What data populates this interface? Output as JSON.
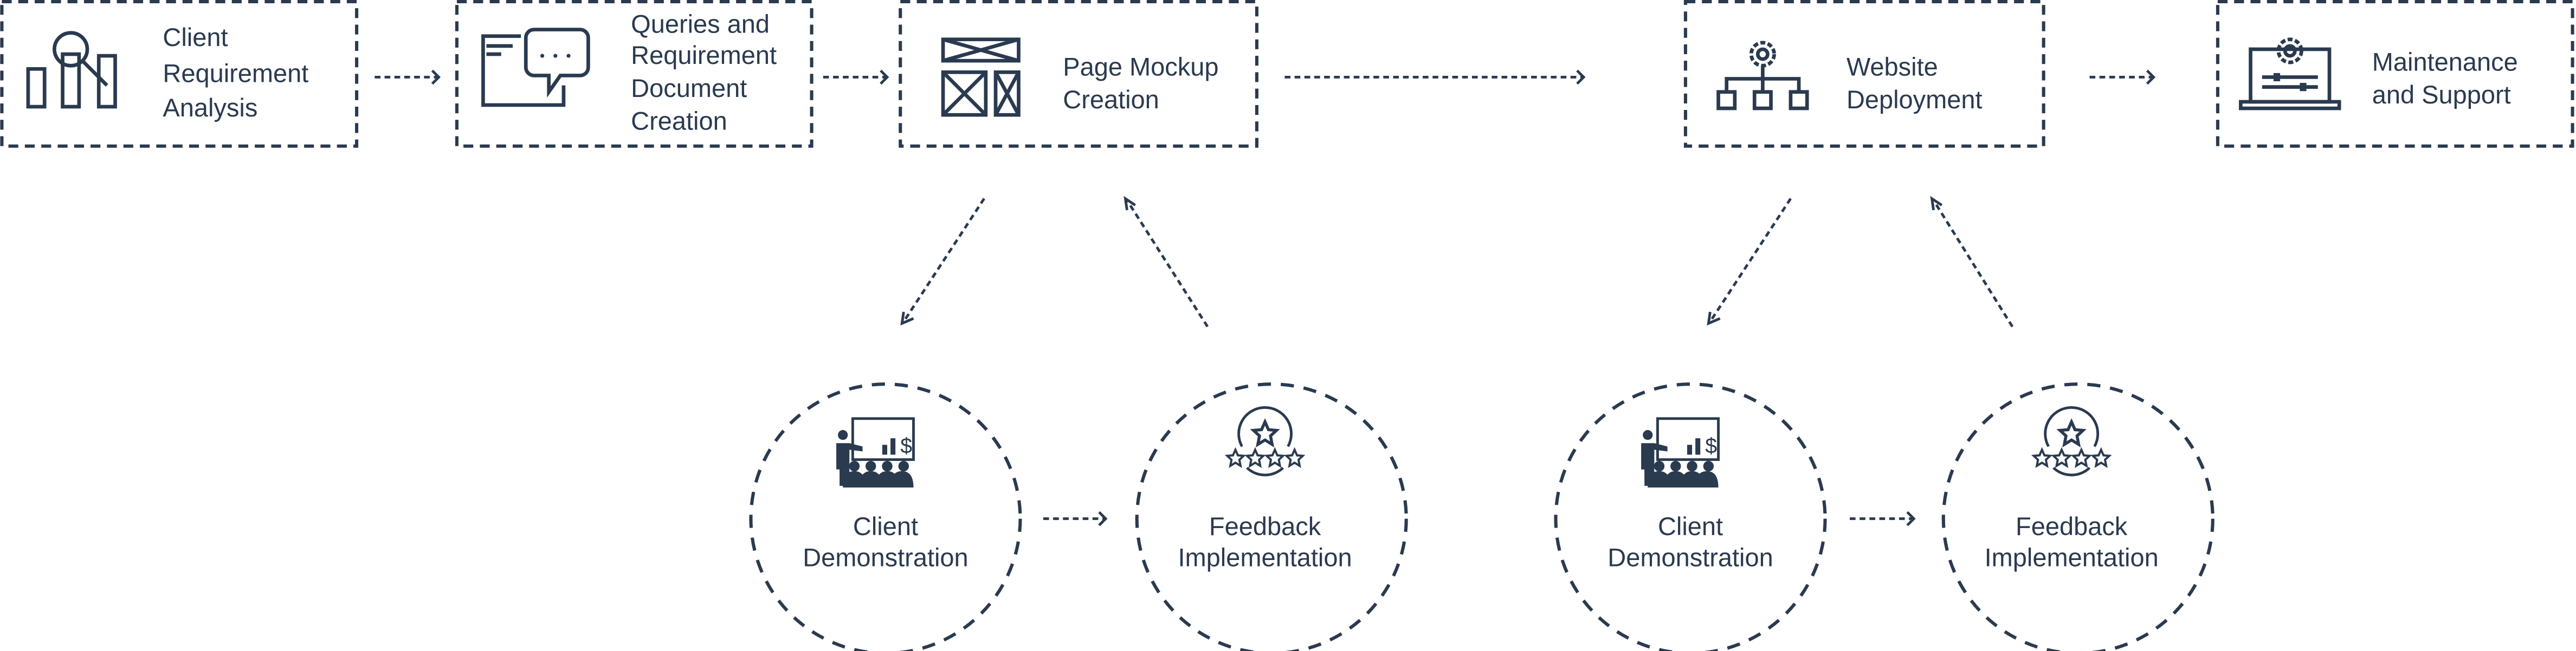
{
  "colors": {
    "ink": "#2a3a4f",
    "background": "#ffffff"
  },
  "steps": [
    {
      "icon": "magnifier-bar-chart-icon",
      "lines": [
        "Client",
        "Requirement",
        "Analysis"
      ]
    },
    {
      "icon": "browser-chat-icon",
      "lines": [
        "Queries and",
        "Requirement",
        "Document",
        "Creation"
      ]
    },
    {
      "icon": "wireframe-icon",
      "lines": [
        "Page Mockup",
        "Creation"
      ]
    },
    {
      "icon": "sitemap-gear-icon",
      "lines": [
        "Website",
        "Deployment"
      ]
    },
    {
      "icon": "laptop-gear-icon",
      "lines": [
        "Maintenance",
        "and Support"
      ]
    }
  ],
  "loops": [
    {
      "demo": {
        "icon": "presentation-icon",
        "lines": [
          "Client",
          "Demonstration"
        ]
      },
      "feedback": {
        "icon": "star-rating-icon",
        "lines": [
          "Feedback",
          "Implementation"
        ]
      }
    },
    {
      "demo": {
        "icon": "presentation-icon",
        "lines": [
          "Client",
          "Demonstration"
        ]
      },
      "feedback": {
        "icon": "star-rating-icon",
        "lines": [
          "Feedback",
          "Implementation"
        ]
      }
    }
  ]
}
